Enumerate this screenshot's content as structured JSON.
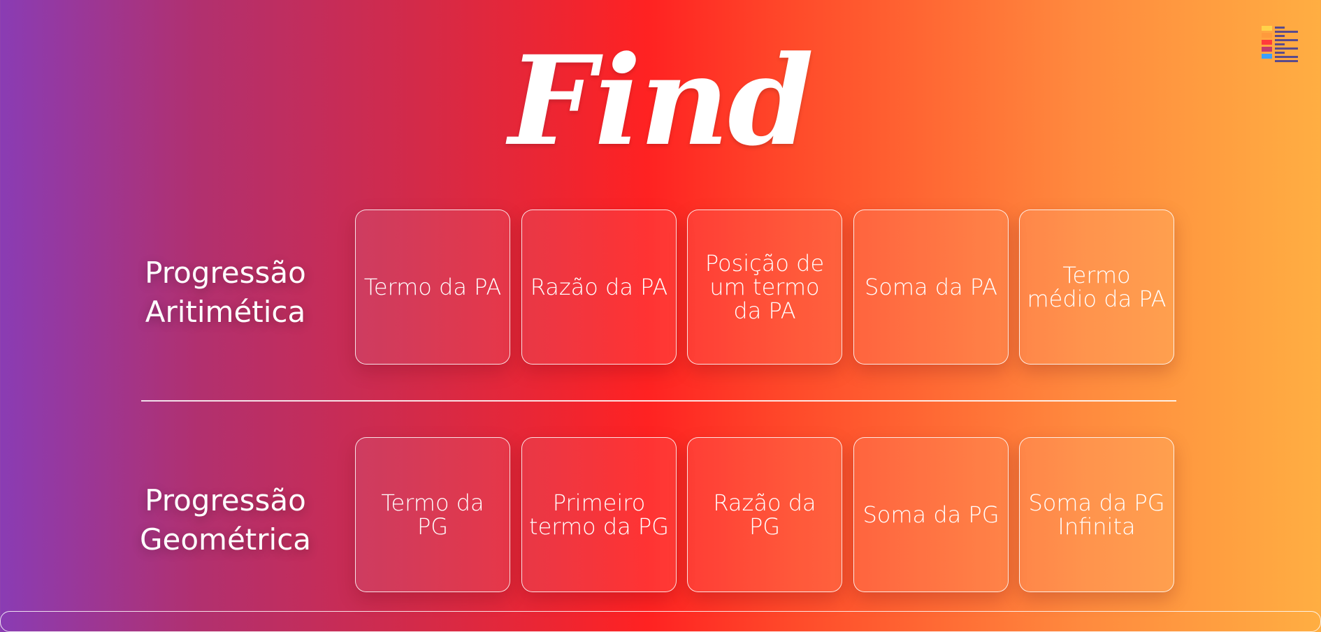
{
  "app": {
    "logo_text": "Find",
    "menu_icon": "color-list-menu-icon"
  },
  "sections": [
    {
      "title_line1": "Progressão",
      "title_line2": "Aritimética",
      "cards": [
        "Termo da PA",
        "Razão da PA",
        "Posição de um termo da PA",
        "Soma da PA",
        "Termo médio da PA"
      ]
    },
    {
      "title_line1": "Progressão",
      "title_line2": "Geométrica",
      "cards": [
        "Termo da PG",
        "Primeiro termo da PG",
        "Razão da PG",
        "Soma da PG",
        "Soma da PG Infinita"
      ]
    }
  ],
  "colors": {
    "gradient_start": "#8a3cb4",
    "gradient_mid": "#ff2222",
    "gradient_end": "#ffae42",
    "text": "#ffffff"
  }
}
